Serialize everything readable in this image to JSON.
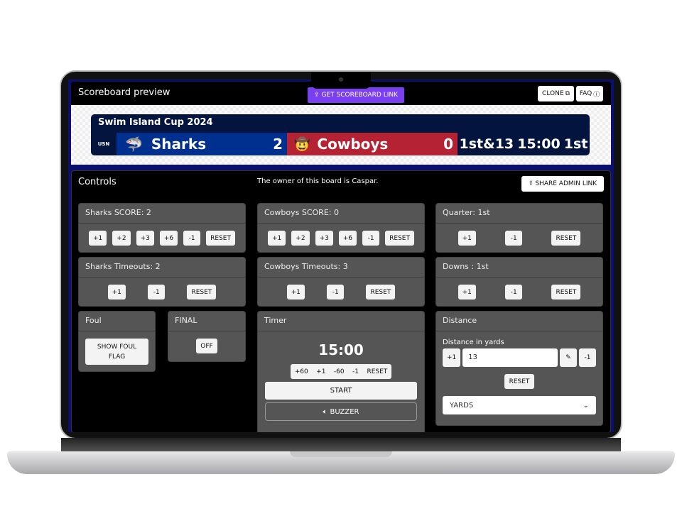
{
  "header": {
    "title": "Scoreboard preview",
    "get_link": "GET SCOREBOARD LINK",
    "clone": "CLONE",
    "faq": "FAQ"
  },
  "scoreboard": {
    "title": "Swim Island Cup 2024",
    "league": "USN",
    "home": {
      "name": "Sharks",
      "score": "2",
      "color": "#00308f"
    },
    "away": {
      "name": "Cowboys",
      "score": "0",
      "color": "#b52233"
    },
    "down_distance": "1st&13",
    "clock": "15:00",
    "quarter": "1st"
  },
  "controls": {
    "title": "Controls",
    "owner_text": "The owner of this board is Caspar.",
    "share_admin": "SHARE ADMIN LINK"
  },
  "panels": {
    "sharks_score": {
      "title": "Sharks SCORE: 2",
      "buttons": [
        "+1",
        "+2",
        "+3",
        "+6",
        "-1",
        "RESET"
      ]
    },
    "cowboys_score": {
      "title": "Cowboys SCORE: 0",
      "buttons": [
        "+1",
        "+2",
        "+3",
        "+6",
        "-1",
        "RESET"
      ]
    },
    "quarter": {
      "title": "Quarter: 1st",
      "buttons": [
        "+1",
        "-1",
        "RESET"
      ]
    },
    "sharks_timeouts": {
      "title": "Sharks Timeouts: 2",
      "buttons": [
        "+1",
        "-1",
        "RESET"
      ]
    },
    "cowboys_timeouts": {
      "title": "Cowboys Timeouts: 3",
      "buttons": [
        "+1",
        "-1",
        "RESET"
      ]
    },
    "downs": {
      "title": "Downs : 1st",
      "buttons": [
        "+1",
        "-1",
        "RESET"
      ]
    },
    "foul": {
      "title": "Foul",
      "button": "SHOW FOUL FLAG"
    },
    "final": {
      "title": "FINAL",
      "button": "OFF"
    },
    "timer": {
      "title": "Timer",
      "value": "15:00",
      "adjust": [
        "+60",
        "+1",
        "-60",
        "-1",
        "RESET"
      ],
      "start": "START",
      "buzzer": "BUZZER"
    },
    "distance": {
      "title": "Distance",
      "label": "Distance in yards",
      "plus": "+1",
      "value": "13",
      "minus": "-1",
      "reset": "RESET",
      "unit": "YARDS"
    }
  },
  "icons": {
    "share": "share-icon",
    "clone": "copy-icon",
    "faq": "question-circle-icon",
    "edit": "pencil-icon",
    "buzzer": "speaker-icon",
    "select": "chevron-down-icon"
  }
}
